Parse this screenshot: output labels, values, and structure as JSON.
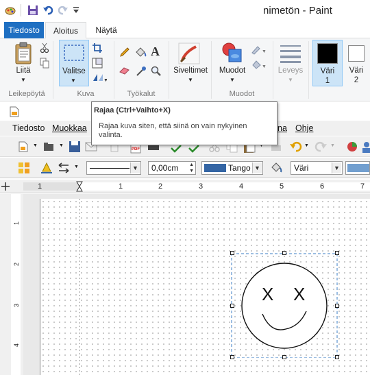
{
  "window": {
    "title": "nimetön - Paint"
  },
  "ribbon_tabs": [
    "Tiedosto",
    "Aloitus",
    "Näytä"
  ],
  "ribbon": {
    "paste": "Liitä",
    "select": "Valitse",
    "brushes": "Siveltimet",
    "shapes": "Muodot",
    "size": "Leveys",
    "color1": "Väri\n1",
    "color1_line1": "Väri",
    "color1_line2": "1",
    "color2_line1": "Väri",
    "color2_line2": "2",
    "groups": {
      "clipboard": "Leikepöytä",
      "image": "Kuva",
      "tools": "Työkalut",
      "shapes": "Muodot"
    },
    "color1_value": "#000000",
    "color2_value": "#ffffff"
  },
  "tooltip": {
    "title": "Rajaa (Ctrl+Vaihto+X)",
    "description": "Rajaa kuva siten, että siinä on vain nykyinen valinta."
  },
  "lo": {
    "menu": [
      "Tiedosto",
      "Muokkaa",
      "na",
      "Ohje"
    ],
    "line_width": "0,00cm",
    "area_style": "Tango",
    "fill": "Väri",
    "colors": {
      "line": "#3465a4",
      "fill": "#729fcf"
    }
  },
  "ruler": {
    "h_ticks": [
      "1",
      "1",
      "2",
      "3",
      "4",
      "5",
      "6",
      "7"
    ],
    "v_ticks": [
      "1",
      "2",
      "3",
      "4"
    ]
  },
  "drawing": {
    "eyes": [
      "X",
      "X"
    ]
  }
}
